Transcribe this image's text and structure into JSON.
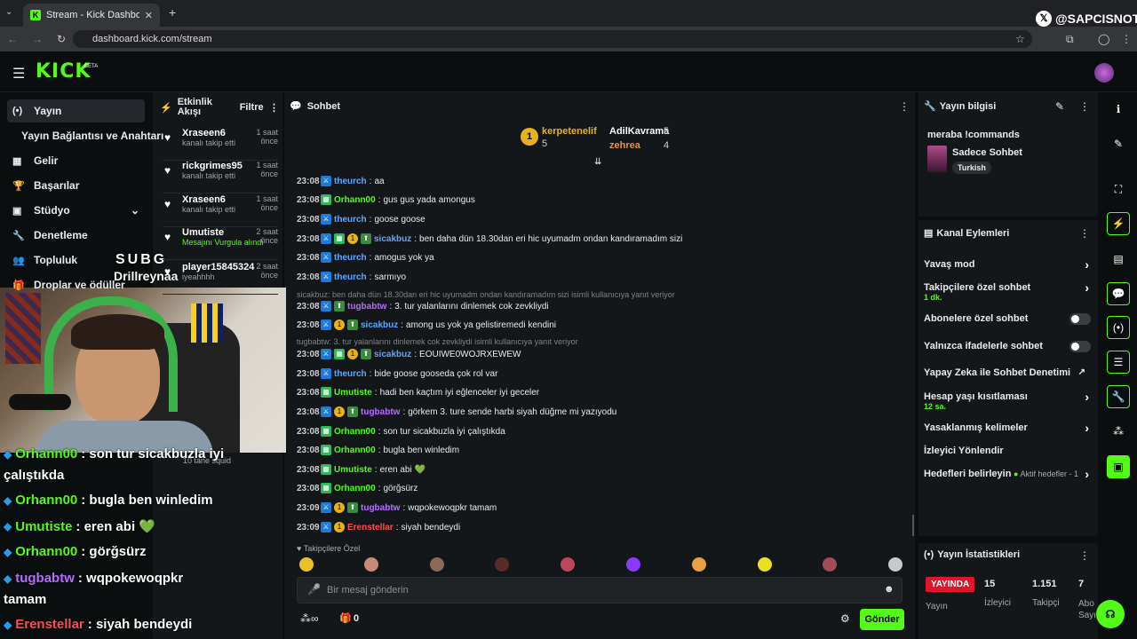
{
  "browser": {
    "tab_title": "Stream - Kick Dashboard",
    "url": "dashboard.kick.com/stream",
    "overlay_handle": "@SAPCISNOT"
  },
  "kick": {
    "logo": "KICK",
    "beta": "BETA"
  },
  "sidebar": {
    "items": [
      {
        "label": "Yayın",
        "icon": "broadcast-icon"
      },
      {
        "label": "Yayın Bağlantısı ve Anahtarı",
        "icon": ""
      },
      {
        "label": "Gelir",
        "icon": "revenue-icon"
      },
      {
        "label": "Başarılar",
        "icon": "trophy-icon"
      },
      {
        "label": "Stüdyo",
        "icon": "studio-icon"
      },
      {
        "label": "Denetleme",
        "icon": "wrench-icon"
      },
      {
        "label": "Topluluk",
        "icon": "community-icon"
      },
      {
        "label": "Droplar ve ödüller",
        "icon": "drops-icon"
      }
    ]
  },
  "activity": {
    "title": "Etkinlik Akışı",
    "filter": "Filtre",
    "items": [
      {
        "name": "Xraseen6",
        "sub": "kanalı takip etti",
        "time": "1 saat önce"
      },
      {
        "name": "rickgrimes95",
        "sub": "kanalı takip etti",
        "time": "1 saat önce"
      },
      {
        "name": "Xraseen6",
        "sub": "kanalı takip etti",
        "time": "1 saat önce"
      },
      {
        "name": "Umutiste",
        "sub": "Mesajını Vurgula alındı",
        "time": "2 saat önce"
      },
      {
        "name": "player15845324",
        "sub": "iyeahhhh",
        "time": "2 saat önce"
      }
    ],
    "bottom_text": "10 tane squid"
  },
  "chat": {
    "title": "Sohbet",
    "leaders": [
      {
        "name": "kerpetenelif",
        "count": "5"
      },
      {
        "name": "AdilKavrama",
        "count": "5"
      },
      {
        "name": "zehrea",
        "count": "4"
      }
    ],
    "messages": [
      {
        "time": "23:08",
        "user": "theurch",
        "color": "#5aa8ff",
        "badges": [
          "blue"
        ],
        "text": "aa"
      },
      {
        "time": "23:08",
        "user": "Orhann00",
        "color": "#53fc18",
        "badges": [
          "green"
        ],
        "text": "gus gus yada amongus"
      },
      {
        "time": "23:08",
        "user": "theurch",
        "color": "#5aa8ff",
        "badges": [
          "blue"
        ],
        "text": "goose goose"
      },
      {
        "time": "23:08",
        "user": "sicakbuz",
        "color": "#5aa8ff",
        "badges": [
          "blue",
          "green",
          "gold",
          "grn2"
        ],
        "text": "ben daha dün 18.30dan eri hic uyumadm ondan kandıramadım sizi"
      },
      {
        "time": "23:08",
        "user": "theurch",
        "color": "#5aa8ff",
        "badges": [
          "blue"
        ],
        "text": "amogus yok ya"
      },
      {
        "time": "23:08",
        "user": "theurch",
        "color": "#5aa8ff",
        "badges": [
          "blue"
        ],
        "text": "sarmıyo"
      },
      {
        "time": "23:08",
        "user": "tugbabtw",
        "color": "#b76cff",
        "badges": [
          "blue",
          "grn2"
        ],
        "text": "3. tur yalanlarını dinlemek cok zevkliydi"
      },
      {
        "time": "23:08",
        "user": "sicakbuz",
        "color": "#5aa8ff",
        "badges": [
          "blue",
          "gold",
          "grn2"
        ],
        "text": "among us yok ya gelistiremedi kendini"
      },
      {
        "time": "23:08",
        "user": "sicakbuz",
        "color": "#5aa8ff",
        "badges": [
          "blue",
          "green",
          "gold",
          "grn2"
        ],
        "text": "EOUIWE0WOJRXEWEW"
      },
      {
        "time": "23:08",
        "user": "theurch",
        "color": "#5aa8ff",
        "badges": [
          "blue"
        ],
        "text": "bide goose gooseda çok rol var"
      },
      {
        "time": "23:08",
        "user": "Umutiste",
        "color": "#53fc18",
        "badges": [
          "green"
        ],
        "text": "hadi ben kaçtım iyi eğlenceler iyi geceler"
      },
      {
        "time": "23:08",
        "user": "tugbabtw",
        "color": "#b76cff",
        "badges": [
          "blue",
          "gold",
          "grn2"
        ],
        "text": "görkem 3. ture sende harbi siyah düğme mi yazıyodu"
      },
      {
        "time": "23:08",
        "user": "Orhann00",
        "color": "#53fc18",
        "badges": [
          "green"
        ],
        "text": "son tur sicakbuzla iyi çalıştıkda"
      },
      {
        "time": "23:08",
        "user": "Orhann00",
        "color": "#53fc18",
        "badges": [
          "green"
        ],
        "text": "bugla ben winledim"
      },
      {
        "time": "23:08",
        "user": "Umutiste",
        "color": "#53fc18",
        "badges": [
          "green"
        ],
        "text": "eren abi 💚"
      },
      {
        "time": "23:08",
        "user": "Orhann00",
        "color": "#53fc18",
        "badges": [
          "green"
        ],
        "text": "görğsürz"
      },
      {
        "time": "23:09",
        "user": "tugbabtw",
        "color": "#b76cff",
        "badges": [
          "blue",
          "gold",
          "grn2"
        ],
        "text": "wqpokewoqpkr tamam"
      },
      {
        "time": "23:09",
        "user": "Erenstellar",
        "color": "#ff4d4d",
        "badges": [
          "blue",
          "gold"
        ],
        "text": "siyah bendeydi"
      }
    ],
    "replies": [
      "sicakbuz: ben daha dün 18.30dan eri hic uyumadm ondan kandıramadım sizi isimli kullanıcıya yanıt veriyor",
      "tugbabtw: 3. tur yalanlarını dinlemek cok zevkliydi isimli kullanıcıya yanıt veriyor"
    ],
    "followers_only": "Takipçilere Özel",
    "input_placeholder": "Bir mesaj gönderin",
    "send": "Gönder",
    "count": "0"
  },
  "stream_info": {
    "title": "Yayın bilgisi",
    "stream_title": "meraba !commands",
    "category": "Sadece Sohbet",
    "language": "Turkish"
  },
  "channel_actions": {
    "title": "Kanal Eylemleri",
    "items": [
      {
        "label": "Yavaş mod",
        "sub": "",
        "kind": "chevron"
      },
      {
        "label": "Takipçilere özel sohbet",
        "sub": "1 dk.",
        "kind": "chevron"
      },
      {
        "label": "Abonelere özel sohbet",
        "sub": "",
        "kind": "toggle"
      },
      {
        "label": "Yalnızca ifadelerle sohbet",
        "sub": "",
        "kind": "toggle"
      },
      {
        "label": "Yapay Zeka ile Sohbet Denetimi",
        "sub": "",
        "kind": "link"
      },
      {
        "label": "Hesap yaşı kısıtlaması",
        "sub": "12 sa.",
        "kind": "chevron"
      },
      {
        "label": "Yasaklanmış kelimeler",
        "sub": "",
        "kind": "chevron"
      },
      {
        "label": "İzleyici Yönlendir",
        "sub": "",
        "kind": "none"
      },
      {
        "label": "Hedefleri belirleyin",
        "sub": "",
        "kind": "goals"
      }
    ],
    "goals_text": "Aktif hedefler - 1"
  },
  "stats": {
    "title": "Yayın İstatistikleri",
    "live": "YAYINDA",
    "viewers": "15",
    "followers": "1.151",
    "subs": "7",
    "l1": "Yayın",
    "l2": "İzleyici",
    "l3": "Takipçi",
    "l4": "Abo\nSayı"
  },
  "overlay": {
    "channel": "SUBG",
    "name": "Drillreynaa",
    "lines": [
      {
        "user": "Orhann00",
        "color": "#53fc18",
        "text": ": son tur sicakbuzla iyi",
        "cont": "çalıştıkda"
      },
      {
        "user": "Orhann00",
        "color": "#53fc18",
        "text": ": bugla ben winledim",
        "cont": ""
      },
      {
        "user": "Umutiste",
        "color": "#53fc18",
        "text": ": eren abi 💚",
        "cont": ""
      },
      {
        "user": "Orhann00",
        "color": "#53fc18",
        "text": ": görğsürz",
        "cont": ""
      },
      {
        "user": "tugbabtw",
        "color": "#b76cff",
        "text": ": wqpokewoqpkr",
        "cont": "tamam"
      },
      {
        "user": "Erenstellar",
        "color": "#ff4d4d",
        "text": ": siyah bendeydi",
        "cont": ""
      }
    ]
  }
}
